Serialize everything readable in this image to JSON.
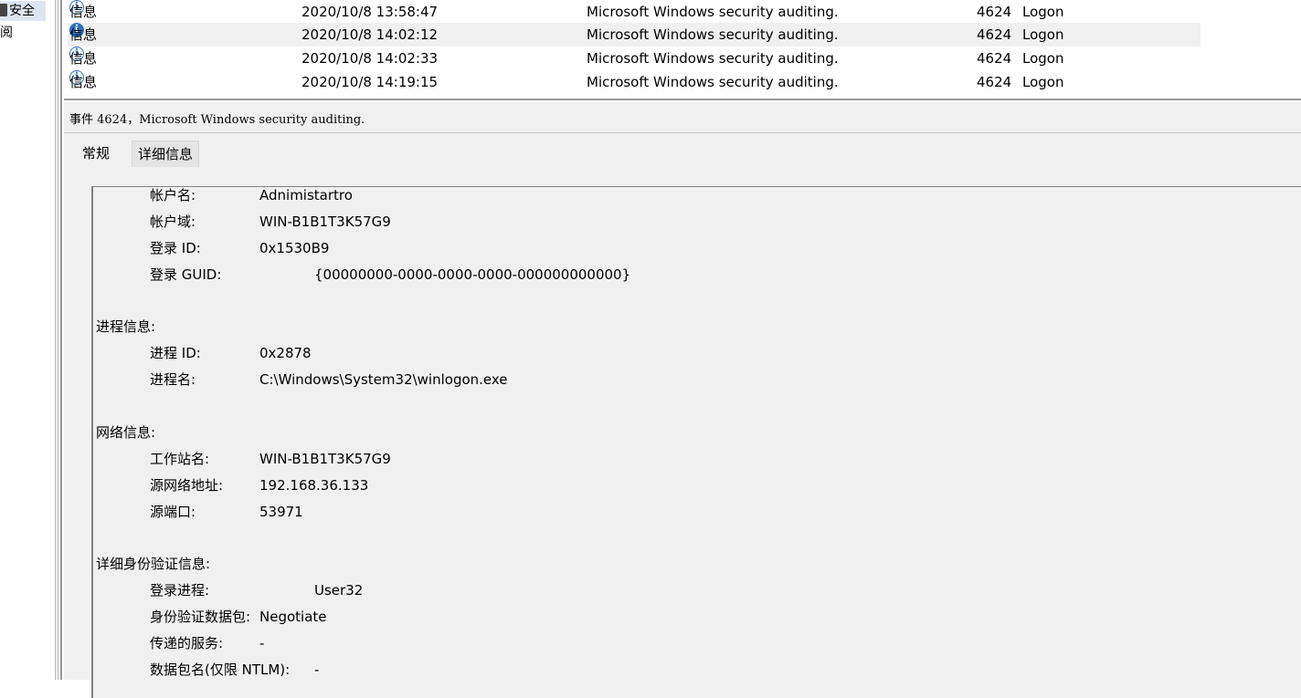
{
  "nav": {
    "items": [
      {
        "label": "安全",
        "selected": true
      },
      {
        "label": "订阅",
        "selected": false
      }
    ]
  },
  "event_list": {
    "rows": [
      {
        "level": "信息",
        "time": "2020/10/8 13:58:47",
        "source": "Microsoft Windows security auditing.",
        "event_id": "4624",
        "task": "Logon"
      },
      {
        "level": "信息",
        "time": "2020/10/8 14:02:12",
        "source": "Microsoft Windows security auditing.",
        "event_id": "4624",
        "task": "Logon"
      },
      {
        "level": "信息",
        "time": "2020/10/8 14:02:33",
        "source": "Microsoft Windows security auditing.",
        "event_id": "4624",
        "task": "Logon"
      },
      {
        "level": "信息",
        "time": "2020/10/8 14:19:15",
        "source": "Microsoft Windows security auditing.",
        "event_id": "4624",
        "task": "Logon"
      }
    ]
  },
  "detail": {
    "header": "事件 4624，Microsoft Windows security auditing.",
    "tabs": [
      "常规",
      "详细信息"
    ],
    "account": [
      {
        "label": "帐户名:",
        "value": "Adnimistartro"
      },
      {
        "label": "帐户域:",
        "value": "WIN-B1B1T3K57G9"
      },
      {
        "label": "登录 ID:",
        "value": "0x1530B9"
      },
      {
        "label": "登录 GUID:",
        "value": "{00000000-0000-0000-0000-000000000000}"
      }
    ],
    "process_section": "进程信息:",
    "process": [
      {
        "label": "进程 ID:",
        "value": "0x2878"
      },
      {
        "label": "进程名:",
        "value": "C:\\Windows\\System32\\winlogon.exe"
      }
    ],
    "network_section": "网络信息:",
    "network": [
      {
        "label": "工作站名:",
        "value": "WIN-B1B1T3K57G9"
      },
      {
        "label": "源网络地址:",
        "value": "192.168.36.133"
      },
      {
        "label": "源端口:",
        "value": "53971"
      }
    ],
    "auth_section": "详细身份验证信息:",
    "auth": [
      {
        "label": "登录进程:",
        "value": "User32"
      },
      {
        "label": "身份验证数据包:",
        "value": "Negotiate"
      },
      {
        "label": "传递的服务:",
        "value": "-"
      },
      {
        "label": "数据包名(仅限 NTLM):",
        "value": "-"
      }
    ]
  },
  "colors": {
    "info_icon": "#2c6fbf",
    "selected_row": "#f0f0f0",
    "detail_bg": "#f0f0f0"
  }
}
